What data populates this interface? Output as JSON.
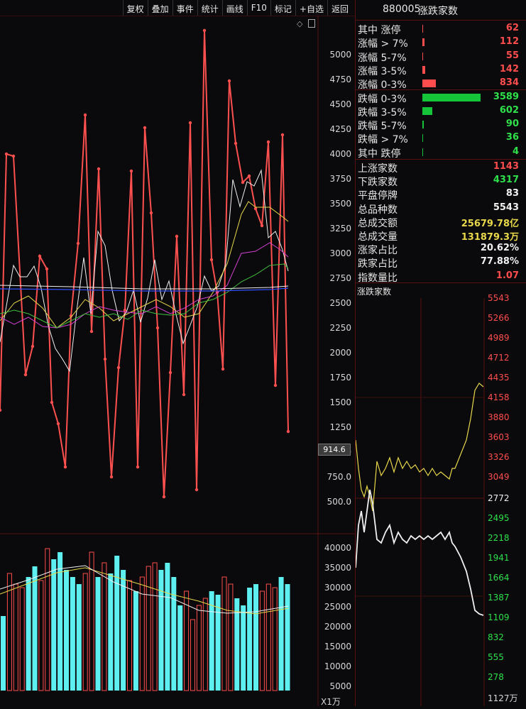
{
  "toolbar": {
    "items": [
      "复权",
      "叠加",
      "事件",
      "统计",
      "画线",
      "F10",
      "标记",
      "+自选",
      "返回"
    ]
  },
  "main_chart": {
    "price_axis": [
      "5000",
      "4750",
      "4500",
      "4250",
      "4000",
      "3750",
      "3500",
      "3250",
      "3000",
      "2750",
      "2500",
      "2250",
      "2000",
      "1750",
      "1500",
      "1250",
      "1000",
      "750.0",
      "500.0"
    ],
    "volume_axis": [
      "40000",
      "35000",
      "30000",
      "25000",
      "20000",
      "15000",
      "10000",
      "5000"
    ],
    "volume_unit": "X1万",
    "cursor_value": "914.6"
  },
  "panel": {
    "code": "880005",
    "name": "涨跌家数",
    "dist_rows": [
      {
        "label": "其中 涨停",
        "value": "62",
        "bar": 1,
        "color": "#ff4d4d"
      },
      {
        "label": "涨幅 > 7%",
        "value": "112",
        "bar": 3,
        "color": "#ff4d4d"
      },
      {
        "label": "涨幅 5-7%",
        "value": "55",
        "bar": 1,
        "color": "#ff4d4d"
      },
      {
        "label": "涨幅 3-5%",
        "value": "142",
        "bar": 4,
        "color": "#ff4d4d"
      },
      {
        "label": "涨幅 0-3%",
        "value": "834",
        "bar": 19,
        "color": "#ff4d4d"
      },
      {
        "label": "跌幅 0-3%",
        "value": "3589",
        "bar": 82,
        "color": "#16c43a"
      },
      {
        "label": "跌幅 3-5%",
        "value": "602",
        "bar": 14,
        "color": "#16c43a"
      },
      {
        "label": "跌幅 5-7%",
        "value": "90",
        "bar": 2,
        "color": "#16c43a"
      },
      {
        "label": "跌幅 > 7%",
        "value": "36",
        "bar": 1,
        "color": "#16c43a"
      },
      {
        "label": "其中 跌停",
        "value": "4",
        "bar": 1,
        "color": "#16c43a"
      }
    ],
    "stats": [
      {
        "label": "上涨家数",
        "value": "1143",
        "cls": "red"
      },
      {
        "label": "下跌家数",
        "value": "4317",
        "cls": "green"
      },
      {
        "label": "平盘停牌",
        "value": "83",
        "cls": "white"
      },
      {
        "label": "总品种数",
        "value": "5543",
        "cls": "white"
      },
      {
        "label": "总成交额",
        "value": "25679.78亿",
        "cls": "yellow"
      },
      {
        "label": "总成交量",
        "value": "131879.3万",
        "cls": "yellow"
      },
      {
        "label": "涨家占比",
        "value": "20.62%",
        "cls": "white"
      },
      {
        "label": "跌家占比",
        "value": "77.88%",
        "cls": "white"
      },
      {
        "label": "指数量比",
        "value": "1.07",
        "cls": "red"
      }
    ],
    "sub_chart_title": "涨跌家数",
    "sub_axis_red": [
      "5543",
      "5266",
      "4989",
      "4712",
      "4435",
      "4158",
      "3880",
      "3603",
      "3326",
      "3049"
    ],
    "sub_axis_mid": "2772",
    "sub_axis_green": [
      "2495",
      "2218",
      "1941",
      "1664",
      "1387",
      "1109",
      "832",
      "555",
      "278"
    ],
    "sub_axis_bottom": "1127万"
  },
  "colors": {
    "up": "#ff4d4d",
    "down": "#16c43a",
    "grid": "#5a1010",
    "cyan": "#5ef0f0"
  }
}
